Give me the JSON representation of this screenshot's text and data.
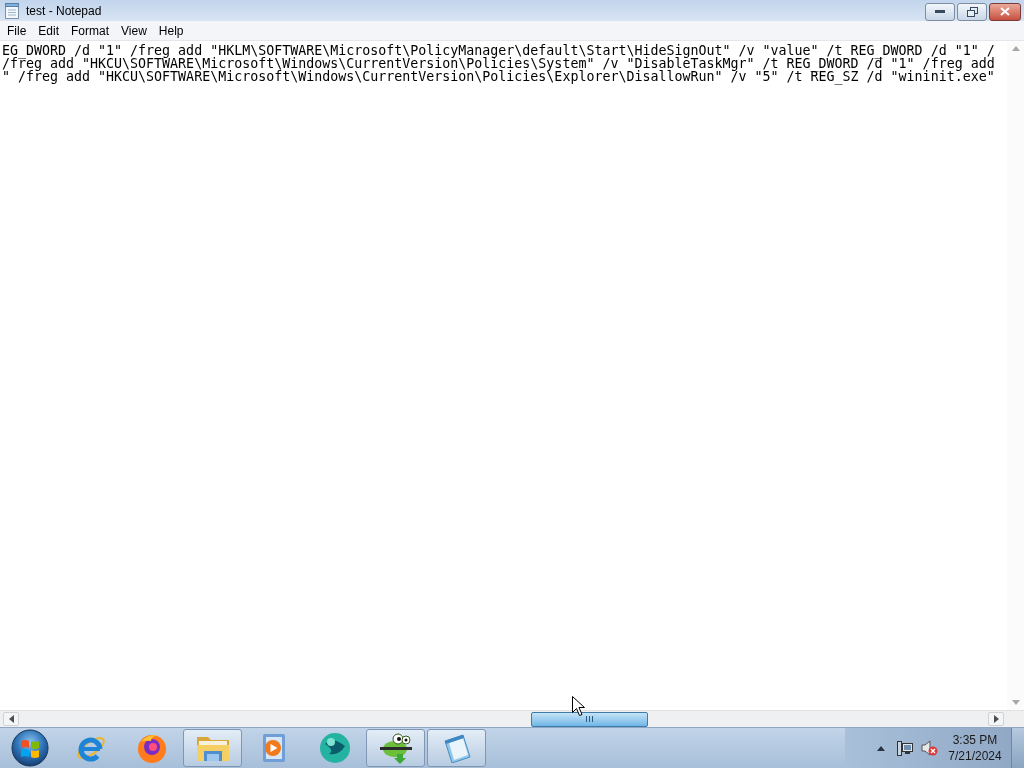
{
  "window": {
    "title": "test - Notepad"
  },
  "menu": [
    "File",
    "Edit",
    "Format",
    "View",
    "Help"
  ],
  "editor": {
    "lines": [
      "EG_DWORD /d \"1\" /freg add \"HKLM\\SOFTWARE\\Microsoft\\PolicyManager\\default\\Start\\HideSignOut\" /v \"value\" /t REG_DWORD /d \"1\" /",
      "/freg add \"HKCU\\SOFTWARE\\Microsoft\\Windows\\CurrentVersion\\Policies\\System\" /v \"DisableTaskMgr\" /t REG_DWORD /d \"1\" /freg add",
      "\" /freg add \"HKCU\\SOFTWARE\\Microsoft\\Windows\\CurrentVersion\\Policies\\Explorer\\DisallowRun\" /v \"5\" /t REG_SZ /d \"wininit.exe\""
    ]
  },
  "taskbar": {
    "apps": [
      {
        "kind": "ie",
        "running": false
      },
      {
        "kind": "fox",
        "running": false
      },
      {
        "kind": "folder",
        "running": true
      },
      {
        "kind": "player",
        "running": false
      },
      {
        "kind": "sphere",
        "running": false
      },
      {
        "kind": "lizard",
        "running": true
      },
      {
        "kind": "notepad",
        "running": true
      }
    ],
    "clock": {
      "time": "3:35 PM",
      "date": "7/21/2024"
    }
  }
}
